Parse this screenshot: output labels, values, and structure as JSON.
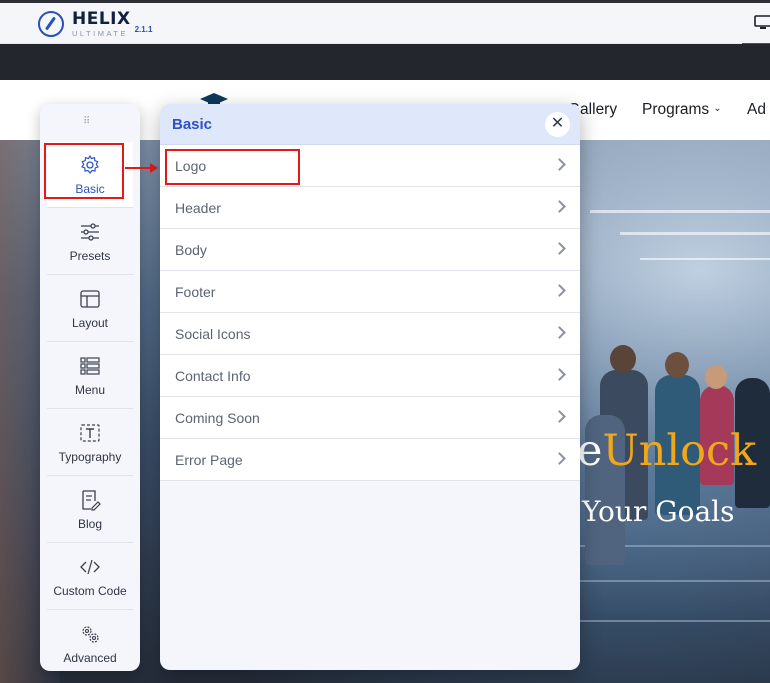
{
  "helix": {
    "name": "HELIX",
    "subtitle": "ULTIMATE",
    "version": "2.1.1"
  },
  "site_nav": {
    "items": [
      "Gallery",
      "Programs",
      "Ad"
    ],
    "caret": "⌄"
  },
  "hero": {
    "unlock_prefix": "e",
    "unlock_word": "Unlock",
    "line2": "Your Goals"
  },
  "toolbar": {
    "grip": "⠿",
    "items": [
      {
        "label": "Basic",
        "icon": "gear-icon"
      },
      {
        "label": "Presets",
        "icon": "sliders-icon"
      },
      {
        "label": "Layout",
        "icon": "layout-icon"
      },
      {
        "label": "Menu",
        "icon": "menu-list-icon"
      },
      {
        "label": "Typography",
        "icon": "typography-icon"
      },
      {
        "label": "Blog",
        "icon": "blog-icon"
      },
      {
        "label": "Custom Code",
        "icon": "code-icon"
      },
      {
        "label": "Advanced",
        "icon": "advanced-gears-icon"
      }
    ],
    "active": "Basic"
  },
  "panel": {
    "title": "Basic",
    "close": "✕",
    "items": [
      "Logo",
      "Header",
      "Body",
      "Footer",
      "Social Icons",
      "Contact Info",
      "Coming Soon",
      "Error Page"
    ]
  },
  "colors": {
    "accent": "#2c52c7",
    "highlight_red": "#e21a1a",
    "hero_gold": "#f0a81a"
  }
}
